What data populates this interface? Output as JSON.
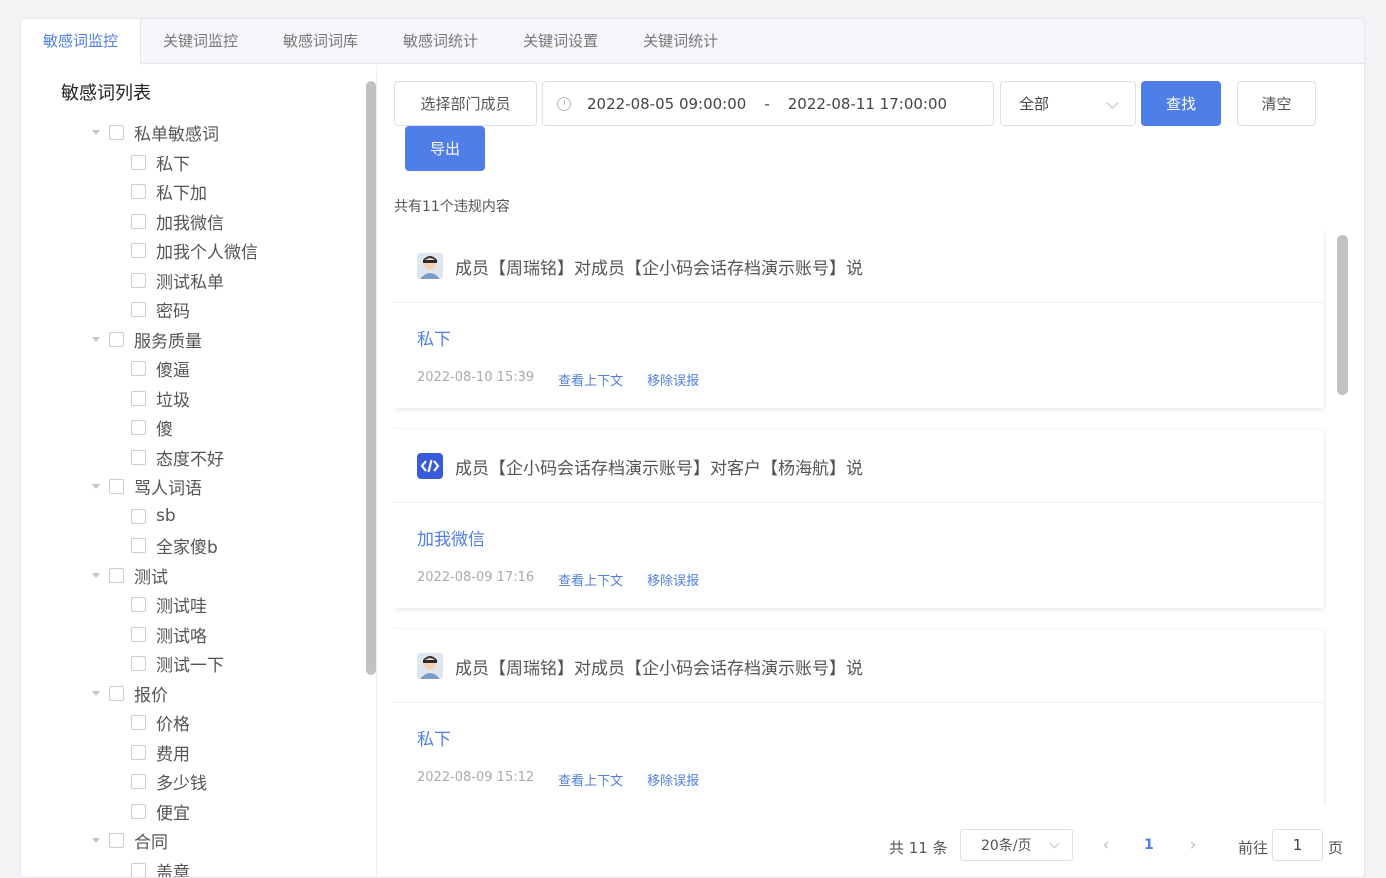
{
  "tabs": [
    "敏感词监控",
    "关键词监控",
    "敏感词词库",
    "敏感词统计",
    "关键词设置",
    "关键词统计"
  ],
  "active_tab": 0,
  "sidebar": {
    "title": "敏感词列表",
    "groups": [
      {
        "label": "私单敏感词",
        "items": [
          "私下",
          "私下加",
          "加我微信",
          "加我个人微信",
          "测试私单",
          "密码"
        ]
      },
      {
        "label": "服务质量",
        "items": [
          "傻逼",
          "垃圾",
          "傻",
          "态度不好"
        ]
      },
      {
        "label": "骂人词语",
        "items": [
          "sb",
          "全家傻b"
        ]
      },
      {
        "label": "测试",
        "items": [
          "测试哇",
          "测试咯",
          "测试一下"
        ]
      },
      {
        "label": "报价",
        "items": [
          "价格",
          "费用",
          "多少钱",
          "便宜"
        ]
      },
      {
        "label": "合同",
        "items": [
          "盖章"
        ]
      }
    ]
  },
  "filters": {
    "member_button": "选择部门成员",
    "date_start": "2022-08-05 09:00:00",
    "date_sep": "-",
    "date_end": "2022-08-11 17:00:00",
    "select_value": "全部",
    "search_button": "查找",
    "clear_button": "清空",
    "export_button": "导出"
  },
  "summary": "共有11个违规内容",
  "records": [
    {
      "avatar": "person-avatar",
      "title": "成员【周瑞铭】对成员【企小码会话存档演示账号】说",
      "word": "私下",
      "time": "2022-08-10 15:39",
      "context_link": "查看上下文",
      "remove_link": "移除误报"
    },
    {
      "avatar": "brand-logo-avatar",
      "title": "成员【企小码会话存档演示账号】对客户【杨海航】说",
      "word": "加我微信",
      "time": "2022-08-09 17:16",
      "context_link": "查看上下文",
      "remove_link": "移除误报"
    },
    {
      "avatar": "person-avatar",
      "title": "成员【周瑞铭】对成员【企小码会话存档演示账号】说",
      "word": "私下",
      "time": "2022-08-09 15:12",
      "context_link": "查看上下文",
      "remove_link": "移除误报"
    }
  ],
  "pagination": {
    "total": "共 11 条",
    "page_size": "20条/页",
    "current_page": "1",
    "goto_label": "前往",
    "goto_value": "1",
    "goto_unit": "页"
  },
  "colors": {
    "accent": "#4f7ee8",
    "brand_logo": "#3a5bd9"
  }
}
